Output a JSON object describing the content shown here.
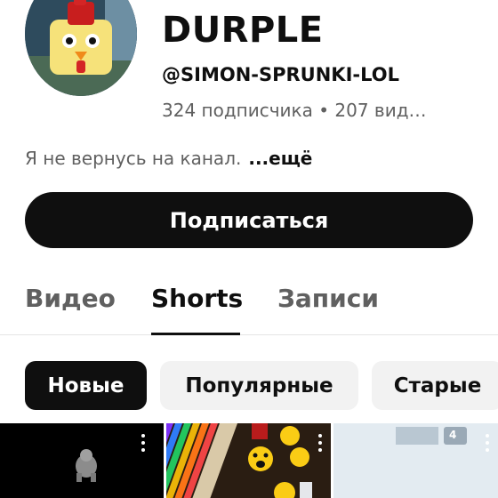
{
  "channel": {
    "name": "DURPLE",
    "handle": "@SIMON-SPRUNKI-LOL",
    "stats": "324 подписчика • 207 вид…",
    "description": "Я не вернусь на канал.",
    "more": "...ещё"
  },
  "subscribe_label": "Подписаться",
  "tabs": [
    {
      "label": "Видео"
    },
    {
      "label": "Shorts"
    },
    {
      "label": "Записи"
    }
  ],
  "active_tab": "Shorts",
  "filters": [
    {
      "label": "Новые"
    },
    {
      "label": "Популярные"
    },
    {
      "label": "Старые"
    }
  ],
  "active_filter": "Новые",
  "shorts_thumbnails": [
    {
      "icon": "gorilla-icon"
    },
    {
      "icon": "emoji-faces-icon"
    },
    {
      "overlay_text": "4"
    }
  ]
}
